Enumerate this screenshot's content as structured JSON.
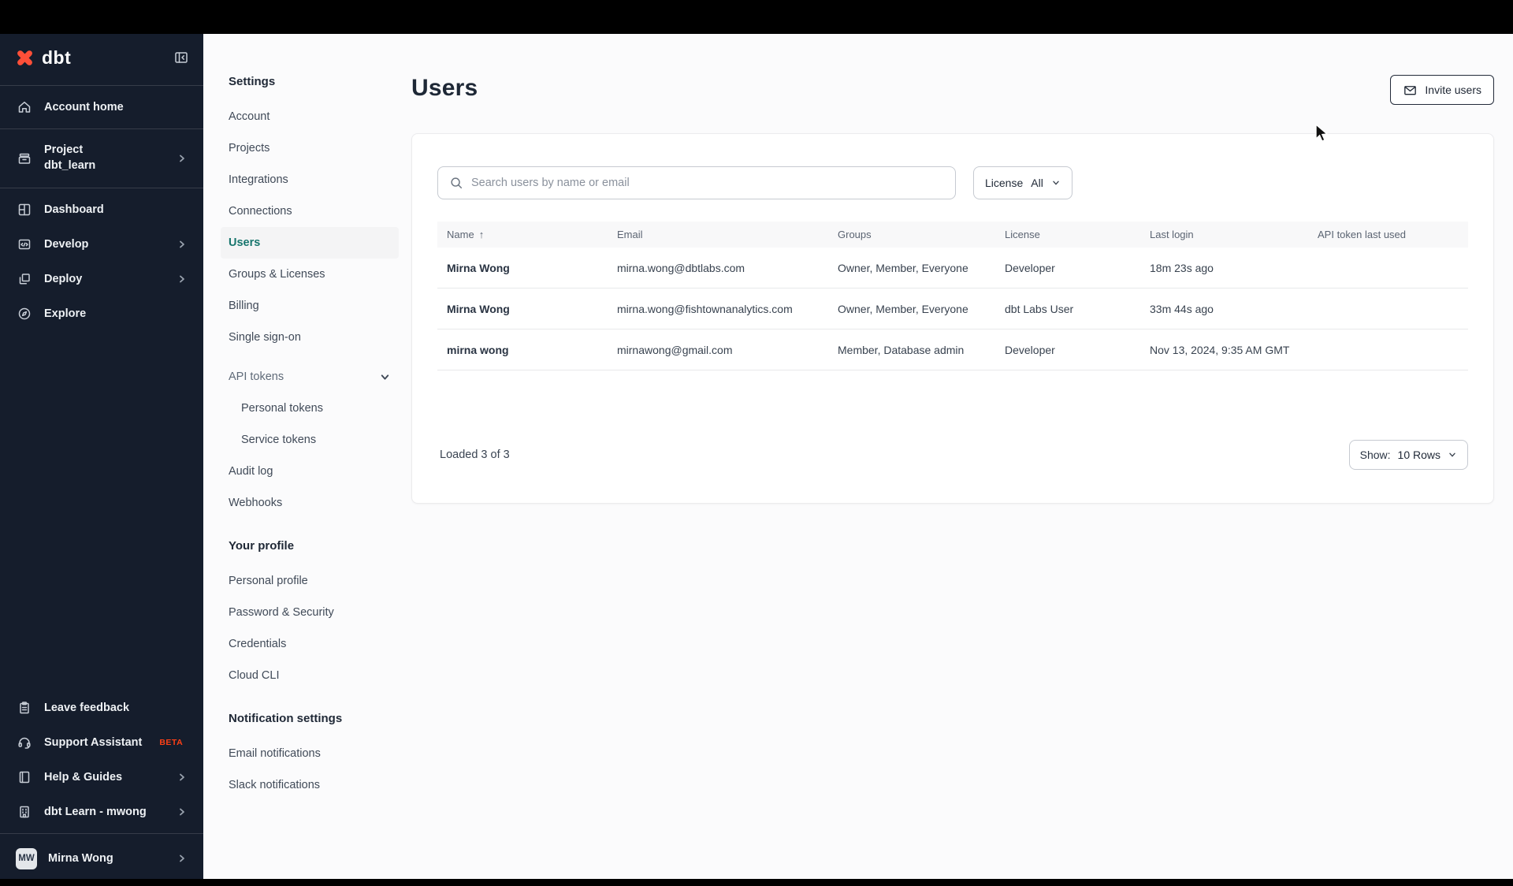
{
  "sidebar": {
    "logo_text": "dbt",
    "account_home": "Account home",
    "project_label": "Project",
    "project_name": "dbt_learn",
    "dashboard": "Dashboard",
    "develop": "Develop",
    "deploy": "Deploy",
    "explore": "Explore",
    "leave_feedback": "Leave feedback",
    "support_assistant": "Support Assistant",
    "beta": "BETA",
    "help_guides": "Help & Guides",
    "learn_account": "dbt Learn - mwong",
    "user_initials": "MW",
    "user_name": "Mirna Wong"
  },
  "settings_nav": {
    "title": "Settings",
    "main_items": [
      "Account",
      "Projects",
      "Integrations",
      "Connections",
      "Users",
      "Groups & Licenses",
      "Billing",
      "Single sign-on"
    ],
    "api_tokens_label": "API tokens",
    "api_children": [
      "Personal tokens",
      "Service tokens"
    ],
    "after_api": [
      "Audit log",
      "Webhooks"
    ],
    "profile_title": "Your profile",
    "profile_items": [
      "Personal profile",
      "Password & Security",
      "Credentials",
      "Cloud CLI"
    ],
    "notif_title": "Notification settings",
    "notif_items": [
      "Email notifications",
      "Slack notifications"
    ]
  },
  "main": {
    "title": "Users",
    "invite_button": "Invite users",
    "search_placeholder": "Search users by name or email",
    "license_filter": {
      "label": "License",
      "value": "All"
    },
    "table": {
      "columns": [
        "Name",
        "Email",
        "Groups",
        "License",
        "Last login",
        "API token last used"
      ],
      "sort_arrow": "↑",
      "rows": [
        {
          "name": "Mirna Wong",
          "email": "mirna.wong@dbtlabs.com",
          "groups": "Owner, Member, Everyone",
          "license": "Developer",
          "last_login": "18m 23s ago",
          "api_token": ""
        },
        {
          "name": "Mirna Wong",
          "email": "mirna.wong@fishtownanalytics.com",
          "groups": "Owner, Member, Everyone",
          "license": "dbt Labs User",
          "last_login": "33m 44s ago",
          "api_token": ""
        },
        {
          "name": "mirna wong",
          "email": "mirnawong@gmail.com",
          "groups": "Member, Database admin",
          "license": "Developer",
          "last_login": "Nov 13, 2024, 9:35 AM GMT",
          "api_token": ""
        }
      ]
    },
    "footer": {
      "loaded": "Loaded 3 of 3",
      "show_label": "Show:",
      "show_value": "10 Rows"
    }
  },
  "colors": {
    "accent_orange": "#ff4f38",
    "active_teal": "#17756d",
    "sidebar_bg": "#151d2c",
    "beta_orange": "#ff4016"
  }
}
